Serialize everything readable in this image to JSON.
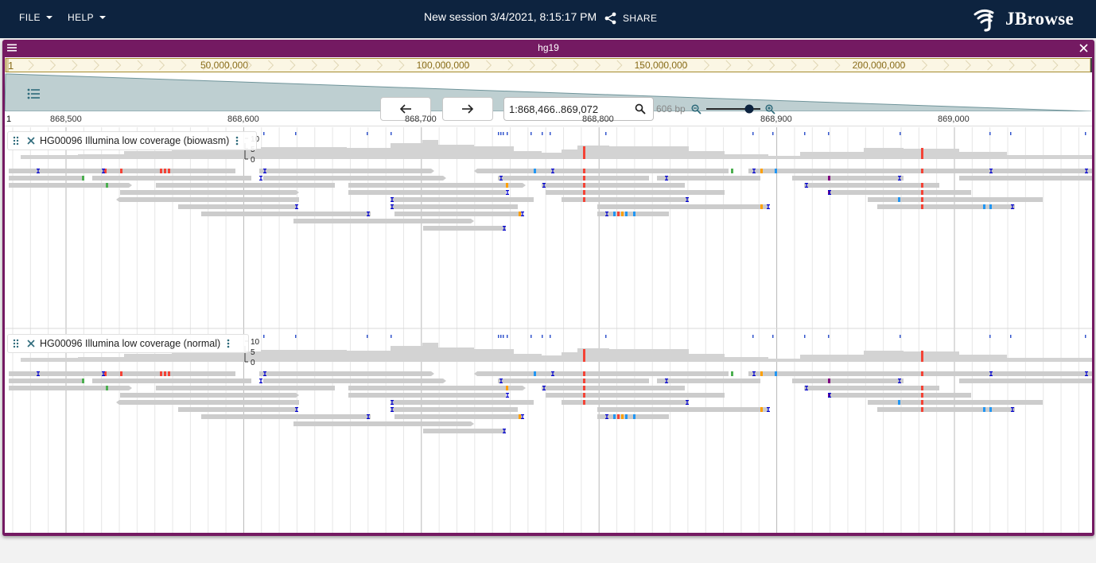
{
  "appbar": {
    "menus": [
      {
        "label": "FILE"
      },
      {
        "label": "HELP"
      }
    ],
    "session_title": "New session 3/4/2021, 8:15:17 PM",
    "share_label": "SHARE",
    "logo_text": "JBrowse"
  },
  "view": {
    "assembly": "hg19",
    "overview": {
      "start_label": "1",
      "ticks": [
        "50,000,000",
        "100,000,000",
        "150,000,000",
        "200,000,000"
      ]
    },
    "nav": {
      "back_icon": "arrow-left-icon",
      "forward_icon": "arrow-right-icon",
      "location": "1:868,466..869,072",
      "span_label": "606 bp"
    },
    "ruler": {
      "refname": "1",
      "ticks": [
        "868,500",
        "868,600",
        "868,700",
        "868,800",
        "868,900",
        "869,000"
      ]
    },
    "tracks": [
      {
        "name": "HG00096 Illumina low coverage (biowasm)",
        "scale": [
          "10",
          "5",
          "0"
        ]
      },
      {
        "name": "HG00096 Illumina low coverage (normal)",
        "scale": [
          "10",
          "5",
          "0"
        ]
      }
    ],
    "colors": {
      "header": "#741a62",
      "appbar": "#0d233f",
      "read": "#cccccc",
      "coverage": "#d3d3d3",
      "mismatch_A": "#4caf50",
      "mismatch_C": "#2196f3",
      "mismatch_G": "#ffa000",
      "mismatch_T": "#f44336",
      "insertion": "#800080",
      "deletion": "#0000cc"
    }
  }
}
